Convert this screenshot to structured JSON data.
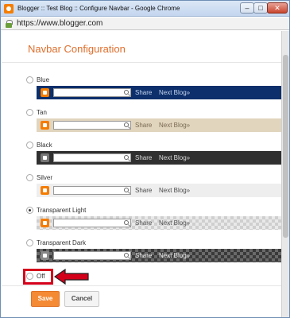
{
  "window": {
    "title": "Blogger :: Test Blog :: Configure Navbar - Google Chrome",
    "minimize_glyph": "–",
    "maximize_glyph": "□",
    "close_glyph": "✕"
  },
  "address_bar": {
    "url": "https://www.blogger.com"
  },
  "dialog": {
    "heading": "Navbar Configuration",
    "options": [
      {
        "label": "Blue",
        "checked": false,
        "style": "blue"
      },
      {
        "label": "Tan",
        "checked": false,
        "style": "tan"
      },
      {
        "label": "Black",
        "checked": false,
        "style": "black"
      },
      {
        "label": "Silver",
        "checked": false,
        "style": "silver"
      },
      {
        "label": "Transparent Light",
        "checked": true,
        "style": "transparent-light"
      },
      {
        "label": "Transparent Dark",
        "checked": false,
        "style": "transparent-dark"
      },
      {
        "label": "Off",
        "checked": false,
        "style": "off"
      }
    ],
    "navbar_preview": {
      "share_label": "Share",
      "next_blog_label": "Next Blog»"
    },
    "save_label": "Save",
    "cancel_label": "Cancel"
  },
  "colors": {
    "accent": "#e06e2b",
    "save_button": "#f48a34",
    "highlight": "#d4001a",
    "blue_navbar": "#0d2f6b",
    "tan_navbar": "#e1d5be",
    "black_navbar": "#303030",
    "silver_navbar": "#eeeeee"
  }
}
